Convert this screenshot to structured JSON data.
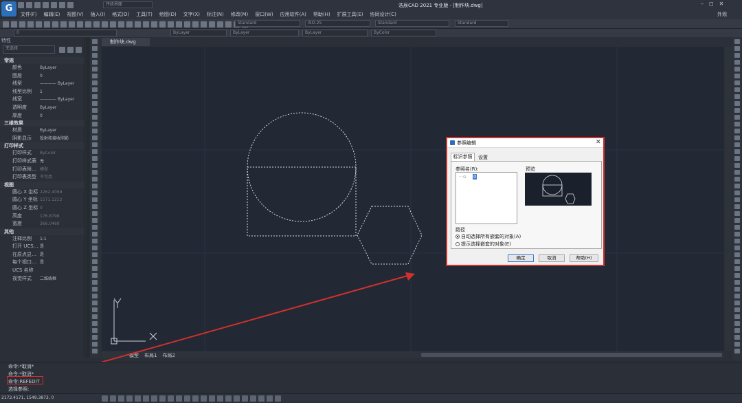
{
  "app": {
    "title": "浩辰CAD 2021 专业版 - [制作块.dwg]",
    "workspace": "传统界面",
    "appearance": "外观"
  },
  "menu": [
    "文件(F)",
    "编辑(E)",
    "视图(V)",
    "插入(I)",
    "格式(O)",
    "工具(T)",
    "绘图(D)",
    "文字(X)",
    "标注(N)",
    "修改(M)",
    "窗口(W)",
    "应用软件(A)",
    "帮助(H)",
    "扩展工具(E)",
    "协同设计(C)"
  ],
  "toolbar2": {
    "layer": "0",
    "color": "ByLayer",
    "linetype": "ByLayer",
    "lineweight": "ByLayer",
    "plotstyle": "ByColor",
    "textstyle": "Standard",
    "dimstyle": "ISO-25",
    "tablestyle": "Standard",
    "mlstyle": "Standard"
  },
  "properties": {
    "panel_title": "特性",
    "selection": "无选择",
    "sections": [
      {
        "title": "常规",
        "rows": [
          {
            "k": "颜色",
            "v": "ByLayer"
          },
          {
            "k": "图层",
            "v": "0"
          },
          {
            "k": "线型",
            "v": "———— ByLayer"
          },
          {
            "k": "线型比例",
            "v": "1"
          },
          {
            "k": "线宽",
            "v": "———— ByLayer"
          },
          {
            "k": "透明度",
            "v": "ByLayer"
          },
          {
            "k": "厚度",
            "v": "0"
          }
        ]
      },
      {
        "title": "三维效果",
        "rows": [
          {
            "k": "材质",
            "v": "ByLayer"
          },
          {
            "k": "阴影显示",
            "v": "投射和接收阴影"
          }
        ]
      },
      {
        "title": "打印样式",
        "rows": [
          {
            "k": "打印样式",
            "v": "ByColor",
            "dim": true
          },
          {
            "k": "打印样式表",
            "v": "无"
          },
          {
            "k": "打印表附…",
            "v": "模型",
            "dim": true
          },
          {
            "k": "打印表类型",
            "v": "不可用",
            "dim": true
          }
        ]
      },
      {
        "title": "视图",
        "rows": [
          {
            "k": "圆心 X 坐标",
            "v": "2262.4099",
            "dim": true
          },
          {
            "k": "圆心 Y 坐标",
            "v": "1571.1212",
            "dim": true
          },
          {
            "k": "圆心 Z 坐标",
            "v": "0",
            "dim": true
          },
          {
            "k": "高度",
            "v": "176.8798",
            "dim": true
          },
          {
            "k": "宽度",
            "v": "366.0460",
            "dim": true
          }
        ]
      },
      {
        "title": "其他",
        "rows": [
          {
            "k": "注释比例",
            "v": "1:1"
          },
          {
            "k": "打开 UCS…",
            "v": "是"
          },
          {
            "k": "在原点显…",
            "v": "是"
          },
          {
            "k": "每个视口…",
            "v": "是"
          },
          {
            "k": "UCS 名称",
            "v": ""
          },
          {
            "k": "视觉样式",
            "v": "二维线框"
          }
        ]
      }
    ]
  },
  "document": {
    "tab": "制作块.dwg"
  },
  "layout_tabs": [
    "模型",
    "布局1",
    "布局2"
  ],
  "ucs": {
    "x": "X",
    "y": "Y"
  },
  "command": {
    "lines": [
      "命令:*取消*",
      "命令:*取消*",
      "命令:REFEDIT",
      "选择参照:"
    ]
  },
  "status": {
    "coords": "2172.4171, 1549.3873, 0"
  },
  "dialog": {
    "title": "参照编辑",
    "tabs": [
      "标识参照",
      "设置"
    ],
    "ref_name_label": "参照名(R):",
    "tree_item": "0",
    "preview_label": "预览",
    "path_label": "路径",
    "option1": "自动选择所有嵌套的对象(A)",
    "option2": "提示选择嵌套的对象(E)",
    "ok": "确定",
    "cancel": "取消",
    "help": "帮助(H)"
  },
  "colors": {
    "canvas": "#222834",
    "highlight": "#d0312d",
    "accent": "#2d6fb8"
  }
}
